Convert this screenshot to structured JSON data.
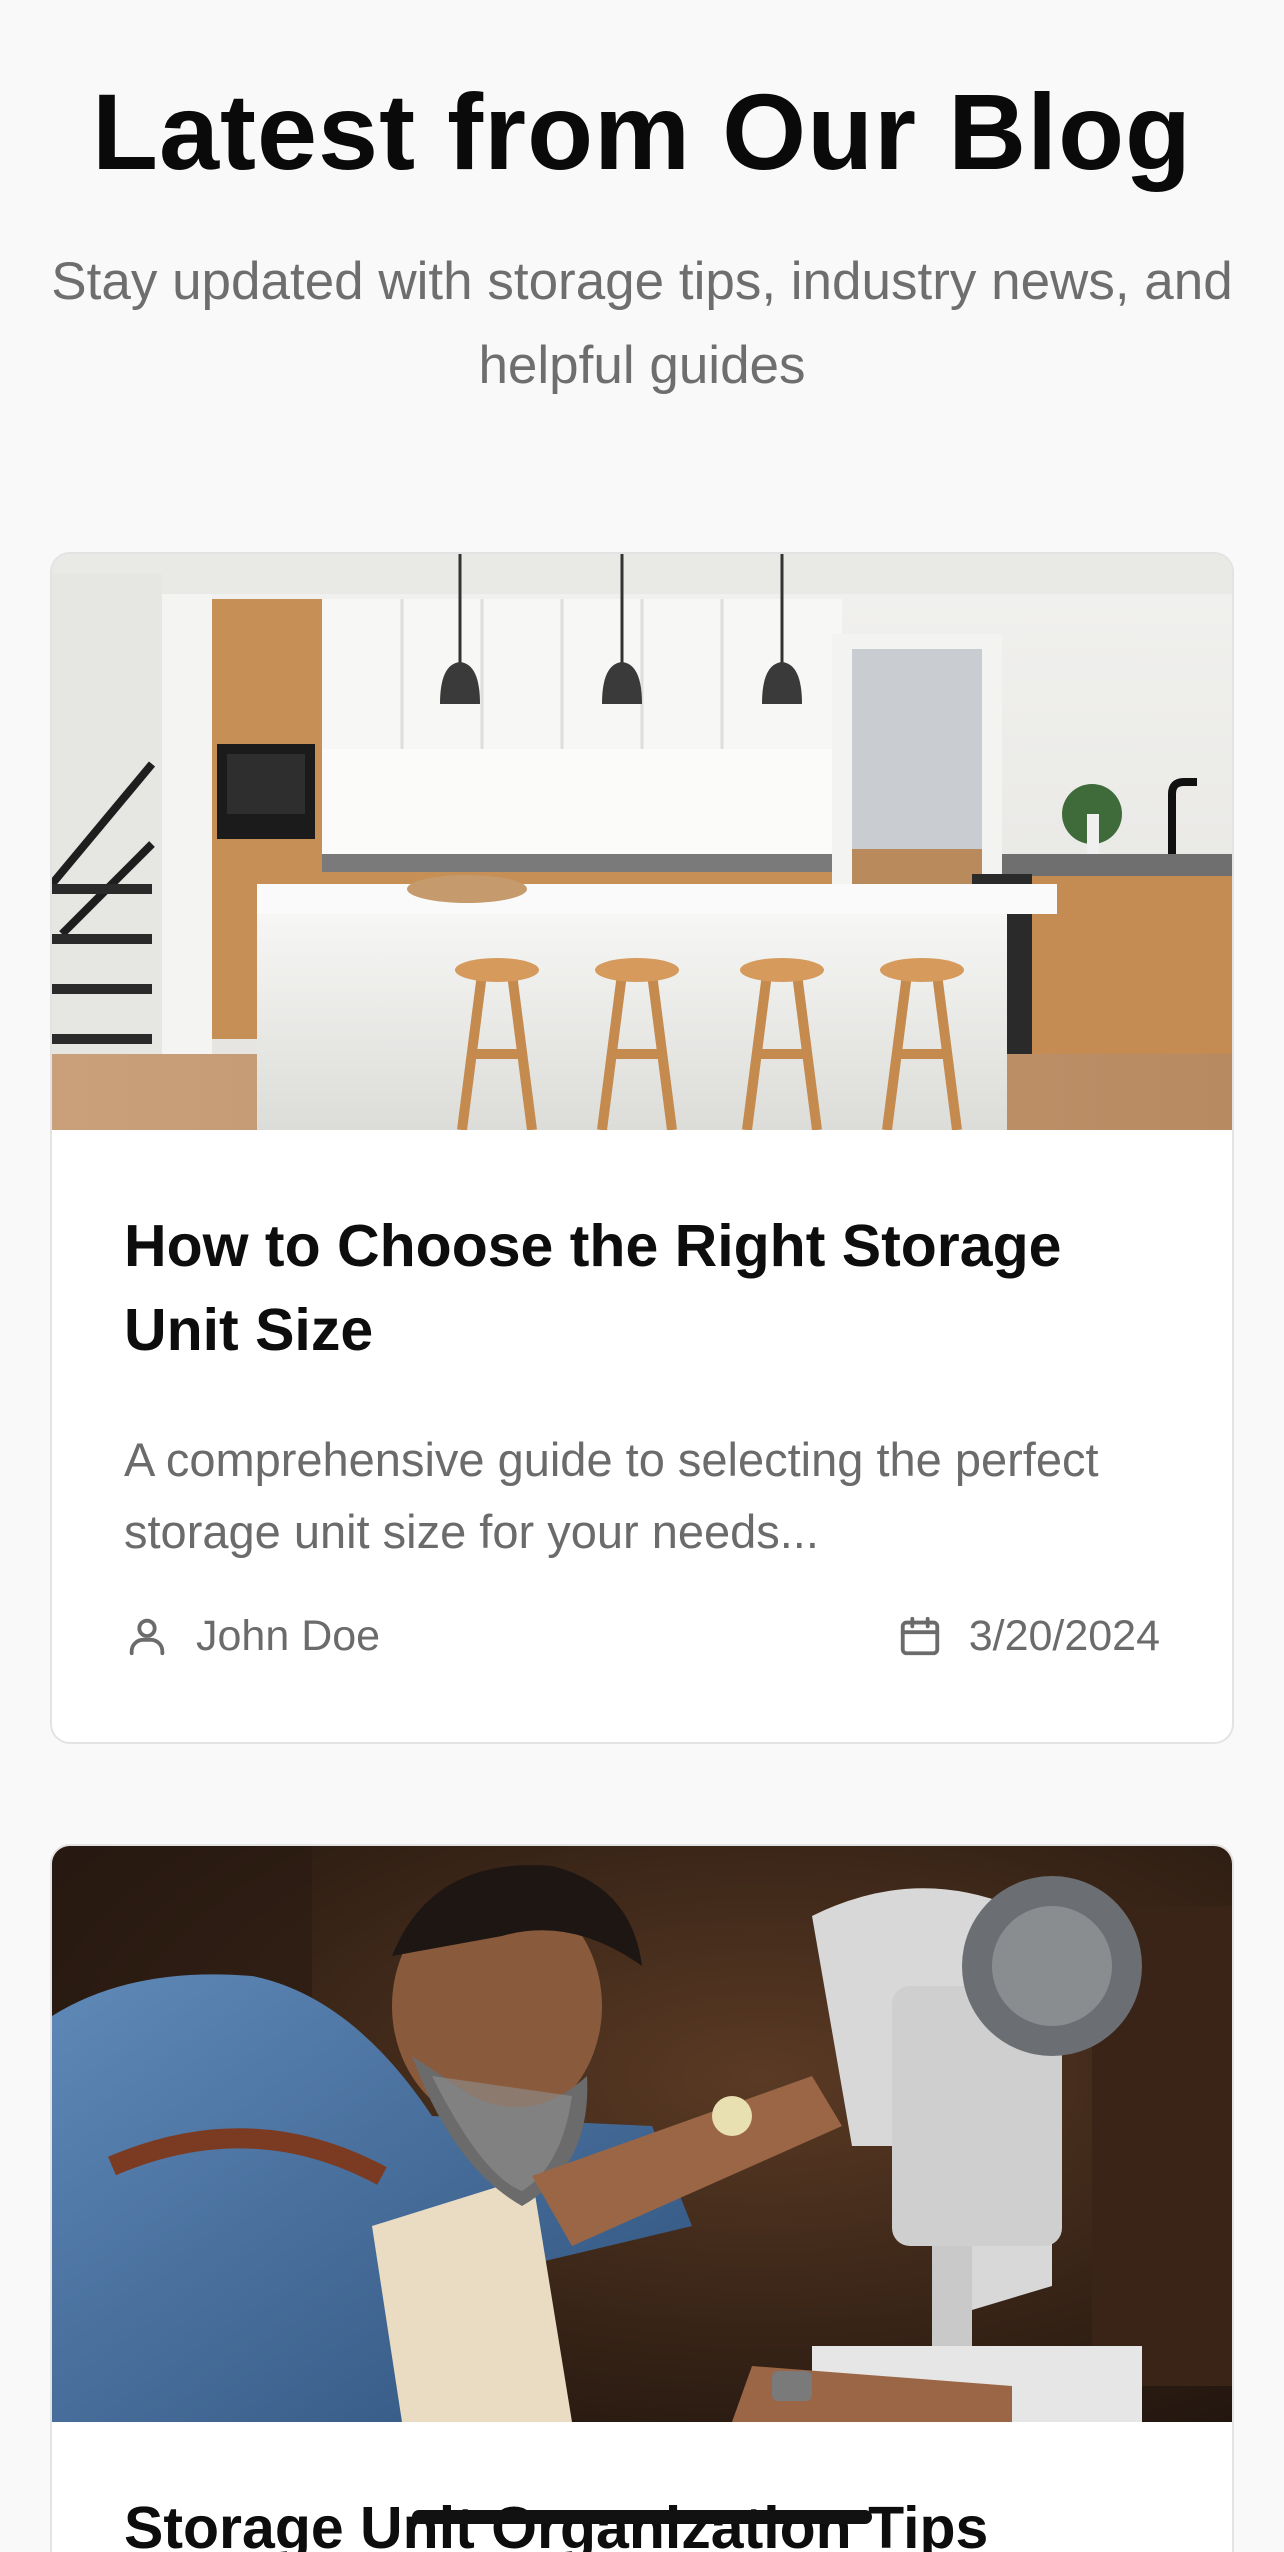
{
  "hero": {
    "title": "Latest from Our Blog",
    "subtitle": "Stay updated with storage tips, industry news, and helpful guides"
  },
  "posts": [
    {
      "title": "How to Choose the Right Storage Unit Size",
      "excerpt": "A comprehensive guide to selecting the perfect storage unit size for your needs...",
      "author": "John Doe",
      "date": "3/20/2024",
      "author_icon": "user-icon",
      "date_icon": "calendar-icon",
      "image": "kitchen-photo"
    },
    {
      "title": "Storage Unit Organization Tips",
      "image": "tailor-at-sewing-machine-photo"
    }
  ],
  "colors": {
    "background": "#f9f9f9",
    "card": "#ffffff",
    "muted_text": "#6b6b6b",
    "heading": "#0a0a0a"
  }
}
